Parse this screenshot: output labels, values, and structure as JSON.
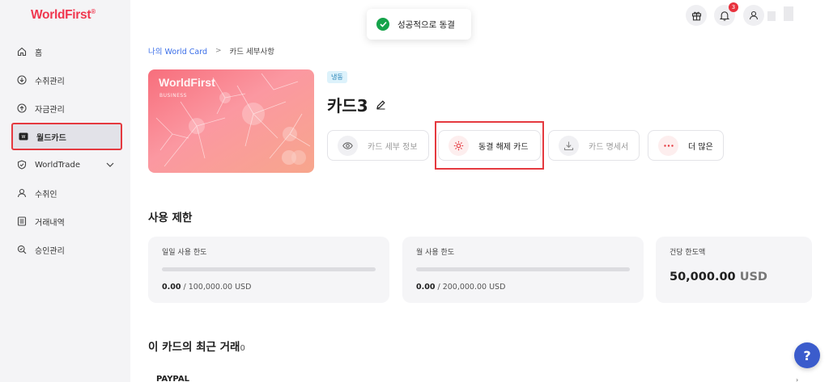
{
  "brand": {
    "name": "WorldFirst",
    "mark": "®",
    "color": "#f0374f"
  },
  "sidebar": {
    "items": [
      {
        "label": "홈",
        "icon": "home-icon"
      },
      {
        "label": "수취관리",
        "icon": "download-circle-icon"
      },
      {
        "label": "자금관리",
        "icon": "upload-circle-icon"
      },
      {
        "label": "월드카드",
        "icon": "card-icon",
        "active": true
      },
      {
        "label": "WorldTrade",
        "icon": "shield-icon",
        "expandable": true
      },
      {
        "label": "수취인",
        "icon": "person-icon"
      },
      {
        "label": "거래내역",
        "icon": "list-icon"
      },
      {
        "label": "승인관리",
        "icon": "search-approve-icon"
      }
    ]
  },
  "topbar": {
    "notification_count": "3"
  },
  "toast": {
    "message": "성공적으로 동결"
  },
  "breadcrumb": {
    "parent": "나의 World Card",
    "separator": ">",
    "current": "카드 세부사항"
  },
  "card": {
    "logo": "WorldFirst",
    "subtitle": "BUSINESS",
    "status_tag": "냉동",
    "name": "카드3"
  },
  "actions": {
    "details": "카드 세부 정보",
    "unfreeze": "동결 해제 카드",
    "statement": "카드 명세서",
    "more": "더 많은"
  },
  "limits": {
    "title": "사용 제한",
    "daily": {
      "label": "일일 사용 한도",
      "used": "0.00",
      "total": " / 100,000.00 USD",
      "progress": 0
    },
    "monthly": {
      "label": "월 사용 한도",
      "used": "0.00",
      "total": " / 200,000.00 USD",
      "progress": 0
    },
    "per_transaction": {
      "label": "건당 한도액",
      "amount": "50,000.00",
      "currency": "USD"
    }
  },
  "transactions": {
    "title": "이 카드의 최근 거래",
    "count": "0",
    "first_merchant": "PAYPAL"
  },
  "help": {
    "label": "?"
  },
  "colors": {
    "accent_red": "#e5393f",
    "link_blue": "#3a6ee8",
    "help_blue": "#3b5ccc",
    "success_green": "#15a34a"
  }
}
